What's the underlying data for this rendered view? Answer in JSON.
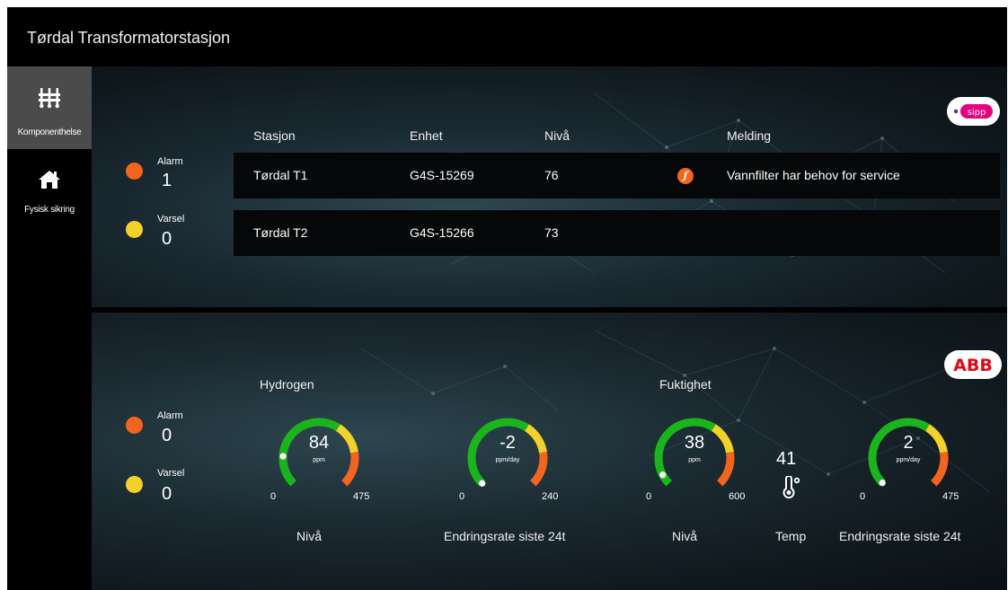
{
  "app": {
    "title": "Tørdal Transformatorstasjon"
  },
  "sidebar": {
    "items": [
      {
        "label": "Komponenthelse",
        "icon": "component-health-icon",
        "active": true
      },
      {
        "label": "Fysisk sikring",
        "icon": "home-icon",
        "active": false
      }
    ]
  },
  "colors": {
    "alarm": "#f2641f",
    "warning": "#f2d12a",
    "ok": "#1cb41c",
    "sipp": "#e6007e",
    "abb": "#e30613"
  },
  "top_panel": {
    "alarm": {
      "label": "Alarm",
      "count": "1"
    },
    "warning": {
      "label": "Varsel",
      "count": "0"
    },
    "columns": {
      "station": "Stasjon",
      "unit": "Enhet",
      "level": "Nivå",
      "message": "Melding"
    },
    "rows": [
      {
        "station": "Tørdal T1",
        "unit": "G4S-15269",
        "level": "76",
        "status_icon": "ƒ",
        "message": "Vannfilter har behov for service"
      },
      {
        "station": "Tørdal T2",
        "unit": "G4S-15266",
        "level": "73",
        "status_icon": "",
        "message": ""
      }
    ],
    "logo": {
      "text": "sipp"
    }
  },
  "bottom_panel": {
    "alarm": {
      "label": "Alarm",
      "count": "0"
    },
    "warning": {
      "label": "Varsel",
      "count": "0"
    },
    "logo": {
      "text": "ABB"
    },
    "hydrogen": {
      "title": "Hydrogen",
      "level": {
        "value": "84",
        "unit": "ppm",
        "min": "0",
        "max": "475",
        "caption": "Nivå",
        "fraction": 0.177
      },
      "rate": {
        "value": "-2",
        "unit": "ppm/day",
        "min": "0",
        "max": "240",
        "caption": "Endringsrate siste 24t",
        "fraction": 0.0
      }
    },
    "humidity": {
      "title": "Fuktighet",
      "level": {
        "value": "38",
        "unit": "ppm",
        "min": "0",
        "max": "600",
        "caption": "Nivå",
        "fraction": 0.063
      },
      "temp": {
        "value": "41",
        "caption": "Temp"
      },
      "rate": {
        "value": "2",
        "unit": "ppm/day",
        "min": "0",
        "max": "475",
        "caption": "Endringsrate siste 24t",
        "fraction": 0.004
      }
    }
  }
}
